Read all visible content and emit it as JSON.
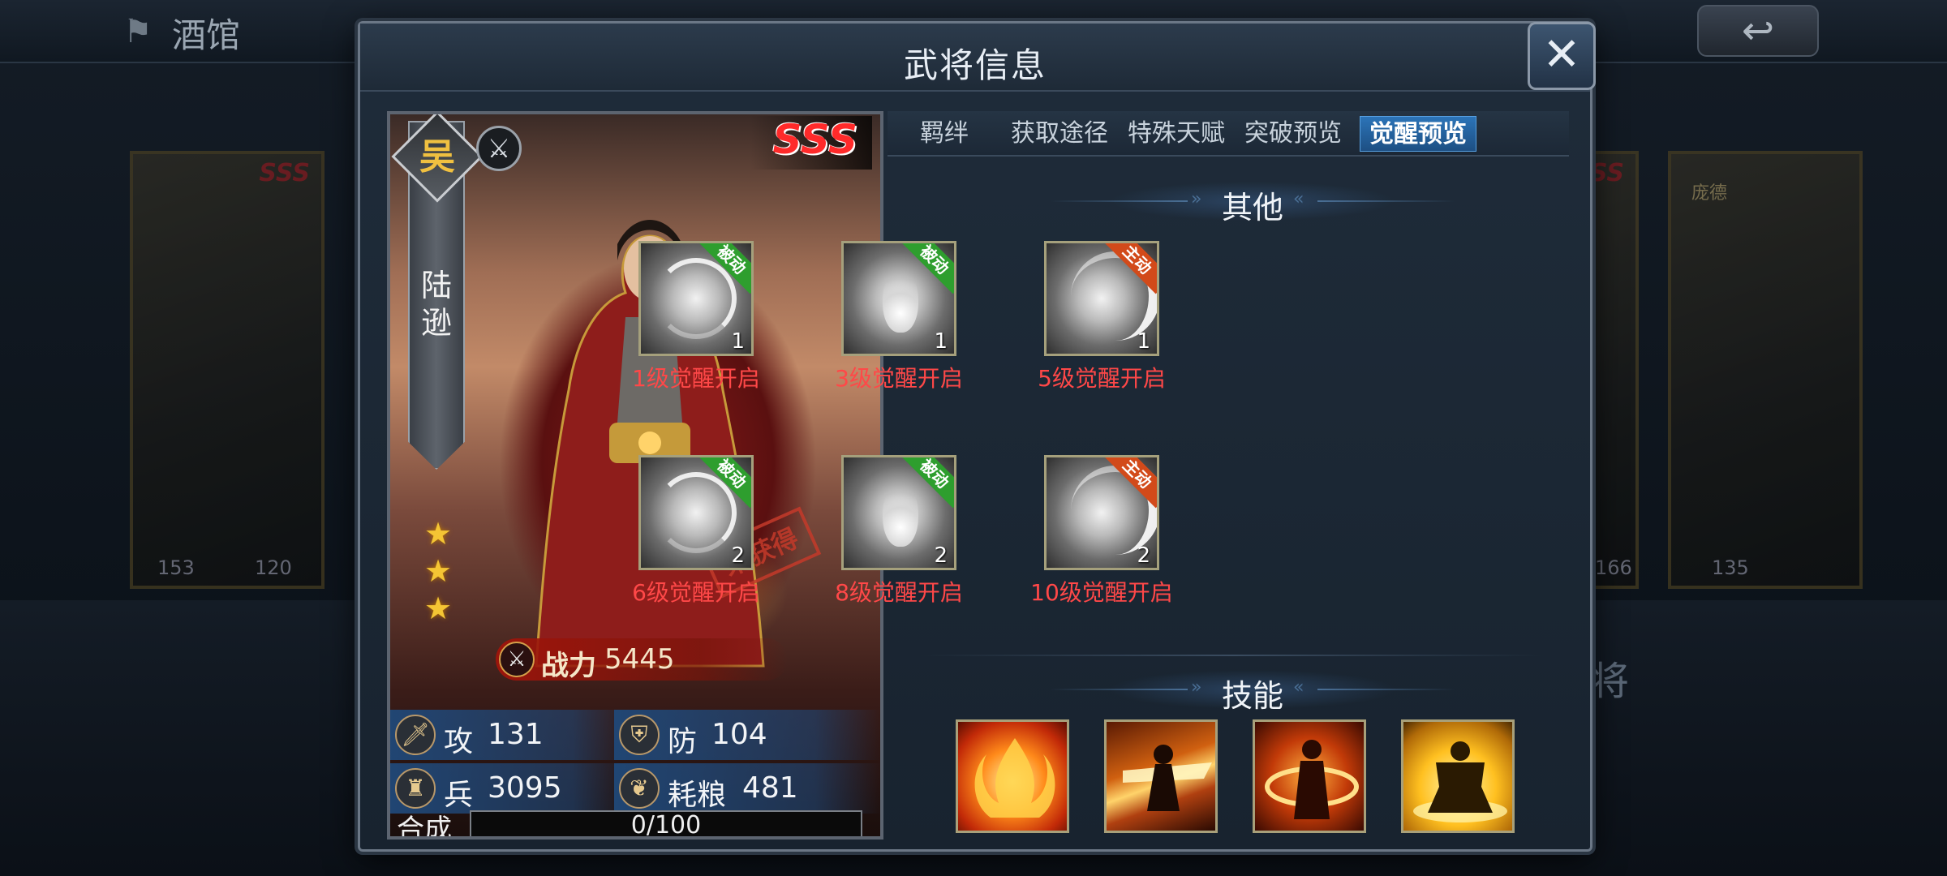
{
  "background": {
    "title": "酒馆",
    "back_icon": "back-arrow-icon",
    "cards": [
      {
        "rarity": "SSS",
        "stat_a": "153",
        "stat_b": "120"
      },
      {
        "rarity": "SSS",
        "stat_a": "166",
        "stat_b": ""
      },
      {
        "rarity": "",
        "name": "庞德",
        "stat_a": "135",
        "stat_b": ""
      }
    ],
    "footer_partial_text": "将"
  },
  "modal": {
    "title": "武将信息",
    "close_icon": "close-icon"
  },
  "hero": {
    "faction": "吴",
    "name": "陆逊",
    "rarity": "SSS",
    "stars": 3,
    "status_stamp": "未获得",
    "power": {
      "label": "战力",
      "value": "5445"
    },
    "stats": {
      "attack": {
        "label": "攻",
        "value": "131"
      },
      "defense": {
        "label": "防",
        "value": "104"
      },
      "troops": {
        "label": "兵",
        "value": "3095"
      },
      "food": {
        "label": "耗粮",
        "value": "481"
      }
    },
    "synthesis": {
      "label": "合成",
      "value": "0/100",
      "current": 0,
      "max": 100
    }
  },
  "tabs": [
    {
      "label": "羁绊",
      "active": false
    },
    {
      "label": "获取途径",
      "active": false
    },
    {
      "label": "特殊天赋",
      "active": false
    },
    {
      "label": "突破预览",
      "active": false
    },
    {
      "label": "觉醒预览",
      "active": true
    }
  ],
  "other_section": {
    "title": "其他",
    "skills": [
      {
        "tag": "被动",
        "type": "passive",
        "level": "1",
        "caption": "1级觉醒开启",
        "icon": "swirl"
      },
      {
        "tag": "被动",
        "type": "passive",
        "level": "1",
        "caption": "3级觉醒开启",
        "icon": "flame"
      },
      {
        "tag": "主动",
        "type": "active",
        "level": "1",
        "caption": "5级觉醒开启",
        "icon": "slash"
      },
      {
        "tag": "被动",
        "type": "passive",
        "level": "2",
        "caption": "6级觉醒开启",
        "icon": "swirl"
      },
      {
        "tag": "被动",
        "type": "passive",
        "level": "2",
        "caption": "8级觉醒开启",
        "icon": "flame"
      },
      {
        "tag": "主动",
        "type": "active",
        "level": "2",
        "caption": "10级觉醒开启",
        "icon": "slash"
      }
    ]
  },
  "skills_section": {
    "title": "技能",
    "skills": [
      {
        "icon": "fire-burst-icon"
      },
      {
        "icon": "lightning-strike-icon"
      },
      {
        "icon": "aura-warrior-icon"
      },
      {
        "icon": "golden-shield-icon"
      }
    ]
  },
  "colors": {
    "active_tab": "#2c74b8",
    "skill_caption": "#ff4848",
    "passive_tag": "#2e9e2e",
    "active_tag": "#d24a1a",
    "rarity": "#ff2a2a"
  }
}
